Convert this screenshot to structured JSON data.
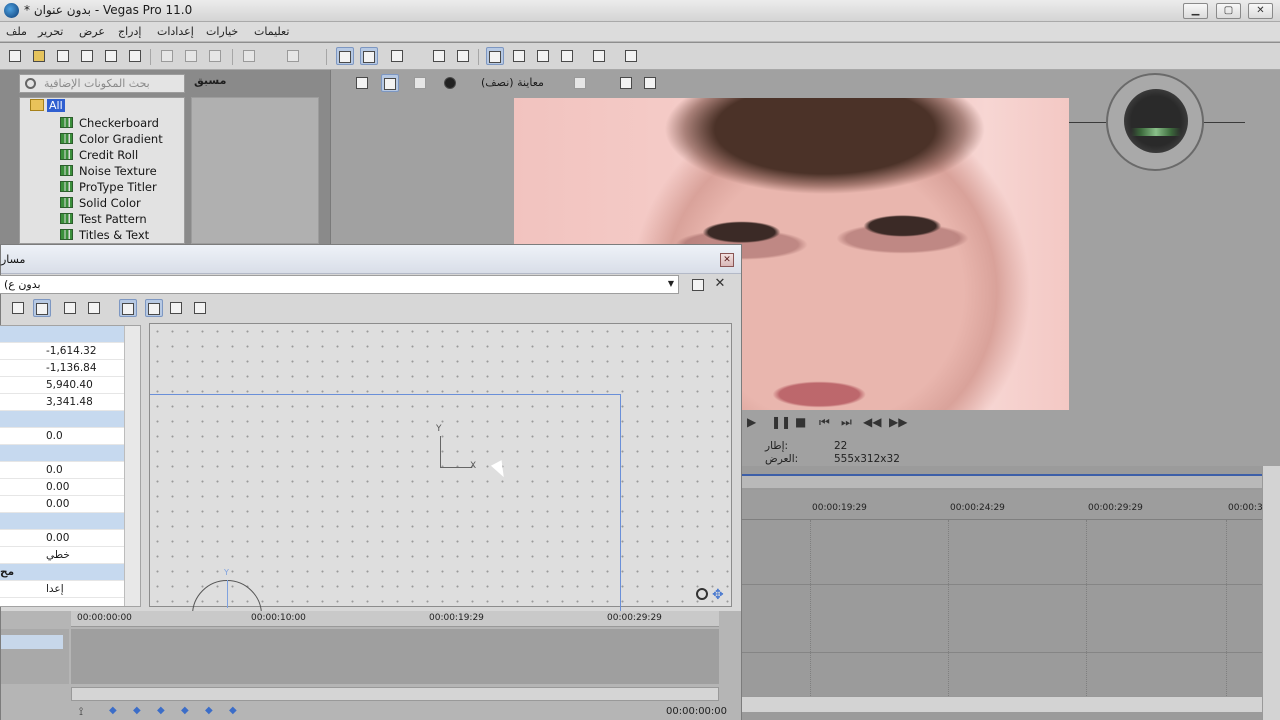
{
  "window": {
    "title": "* بدون عنوان - Vegas Pro 11.0",
    "controls": {
      "minimize": "▁",
      "maximize": "▢",
      "close": "✕"
    }
  },
  "menu": {
    "items": [
      "ملف",
      "تحرير",
      "عرض",
      "إدراج",
      "إعدادات",
      "خيارات",
      "تعليمات"
    ]
  },
  "plugins": {
    "search_placeholder": "بحث المكونات الإضافية",
    "root": "All",
    "items": [
      "Checkerboard",
      "Color Gradient",
      "Credit Roll",
      "Noise Texture",
      "ProType Titler",
      "Solid Color",
      "Test Pattern",
      "Titles & Text"
    ],
    "presets_label": "مسبق"
  },
  "preview": {
    "quality": "معاينة (نصف)",
    "frame_label": "إطار:",
    "frame_value": "22",
    "display_label": "العرض:",
    "display_value": "555x312x32"
  },
  "timeline": {
    "ticks": [
      "00:00:19:29",
      "00:00:24:29",
      "00:00:29:29",
      "00:00:3"
    ]
  },
  "dialog": {
    "title": "مسار",
    "preset": "(بدون ع",
    "close": "✕",
    "props": [
      {
        "kind": "hdr",
        "value": ""
      },
      {
        "kind": "row",
        "value": "-1,614.32"
      },
      {
        "kind": "row",
        "value": "-1,136.84"
      },
      {
        "kind": "row",
        "value": "5,940.40"
      },
      {
        "kind": "row",
        "value": "3,341.48"
      },
      {
        "kind": "hdr",
        "value": ""
      },
      {
        "kind": "row",
        "value": "0.0"
      },
      {
        "kind": "hdr",
        "value": ""
      },
      {
        "kind": "row",
        "value": "0.0"
      },
      {
        "kind": "row",
        "value": "0.00"
      },
      {
        "kind": "row",
        "value": "0.00"
      },
      {
        "kind": "hdr",
        "value": ""
      },
      {
        "kind": "row",
        "value": "0.00"
      },
      {
        "kind": "row",
        "value": "خطي"
      },
      {
        "kind": "hdr",
        "value": "مح"
      },
      {
        "kind": "row",
        "value": "إعدا"
      }
    ],
    "axis_x": "X",
    "axis_y": "Y",
    "rot_y": "Y",
    "ticks": [
      "00:00:00:00",
      "00:00:10:00",
      "00:00:19:29",
      "00:00:29:29"
    ],
    "timecode": "00:00:00:00"
  }
}
